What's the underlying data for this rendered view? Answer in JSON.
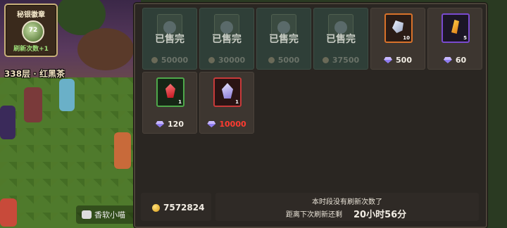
{
  "badge": {
    "title": "秘银徽章",
    "icon_text": "72",
    "refresh_count": "刷新次数+1"
  },
  "floor_label": "338层 · 红黑茶",
  "chat": {
    "text": "香软小喵"
  },
  "shop": {
    "items": [
      {
        "status": "已售完",
        "price": "50000",
        "currency": "coin-icon",
        "sold": true
      },
      {
        "status": "已售完",
        "price": "30000",
        "currency": "coin-icon",
        "sold": true
      },
      {
        "status": "已售完",
        "price": "5000",
        "currency": "coin-icon",
        "sold": true
      },
      {
        "status": "已售完",
        "price": "37500",
        "currency": "coin-icon",
        "sold": true
      },
      {
        "qty": "10",
        "price": "500",
        "currency": "diamond-icon",
        "item_icon": "silver-ore-icon"
      },
      {
        "qty": "5",
        "price": "60",
        "currency": "diamond-icon",
        "item_icon": "gold-shard-icon"
      },
      {
        "qty": "1",
        "price": "120",
        "currency": "diamond-icon",
        "item_icon": "red-gem-icon"
      },
      {
        "qty": "1",
        "price": "10000",
        "currency": "diamond-icon",
        "item_icon": "crystal-icon",
        "price_color": "#ff3b30"
      }
    ]
  },
  "footer": {
    "gold_amount": "7572824",
    "no_refresh_msg": "本时段没有刷新次数了",
    "next_refresh_label": "距离下次刷新还剩",
    "next_refresh_time": "20小时56分"
  },
  "colors": {
    "panel_bg": "#2a2622",
    "sold_cell": "#2f3f38",
    "price_red": "#ff3b30"
  }
}
